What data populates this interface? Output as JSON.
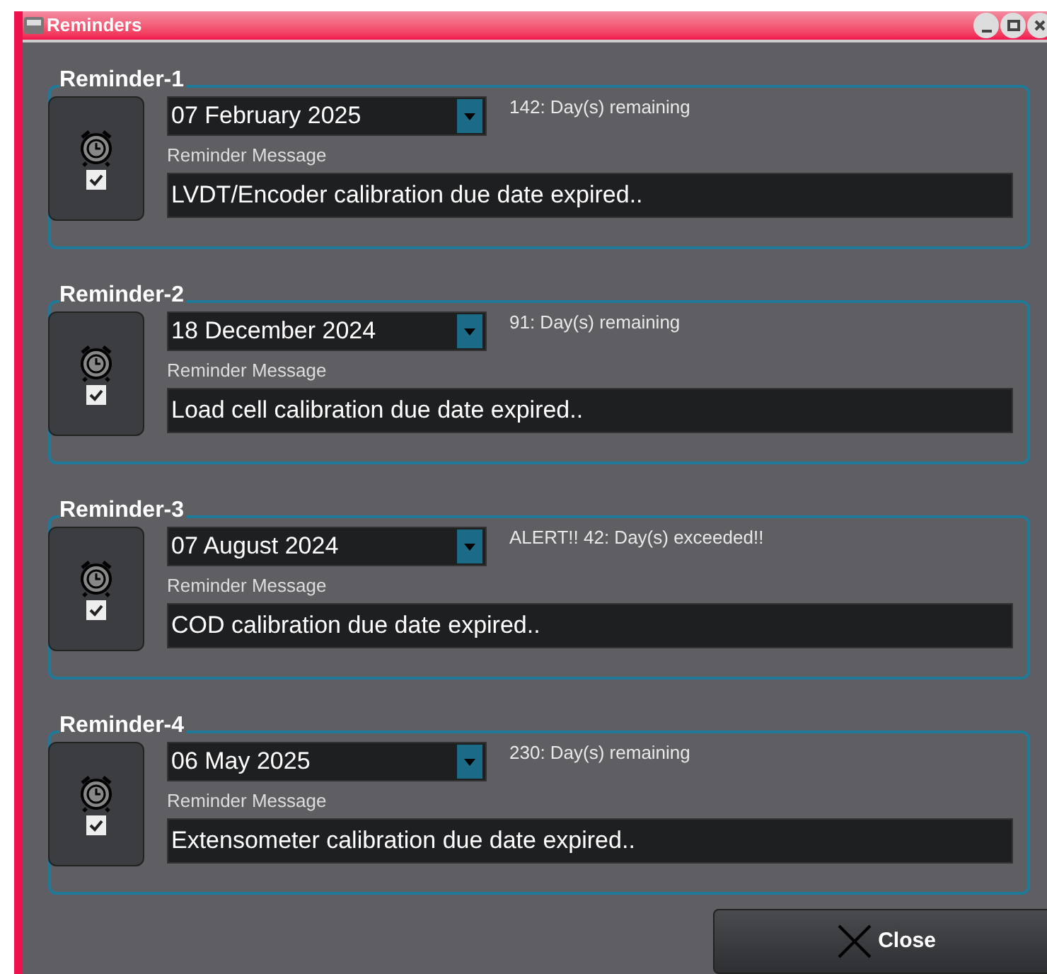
{
  "window": {
    "title": "Reminders"
  },
  "reminders": [
    {
      "title": "Reminder-1",
      "date": "07 February 2025",
      "status": "142: Day(s) remaining",
      "message_label": "Reminder Message",
      "message": "LVDT/Encoder calibration due date expired..",
      "checked": true
    },
    {
      "title": "Reminder-2",
      "date": "18 December 2024",
      "status": "91: Day(s) remaining",
      "message_label": "Reminder Message",
      "message": "Load cell calibration due date expired..",
      "checked": true
    },
    {
      "title": "Reminder-3",
      "date": "07 August 2024",
      "status": "ALERT!! 42: Day(s) exceeded!!",
      "message_label": "Reminder Message",
      "message": "COD calibration due date expired..",
      "checked": true
    },
    {
      "title": "Reminder-4",
      "date": "06 May 2025",
      "status": "230: Day(s) remaining",
      "message_label": "Reminder Message",
      "message": "Extensometer calibration due date expired..",
      "checked": true
    }
  ],
  "close_button": {
    "label": "Close"
  }
}
